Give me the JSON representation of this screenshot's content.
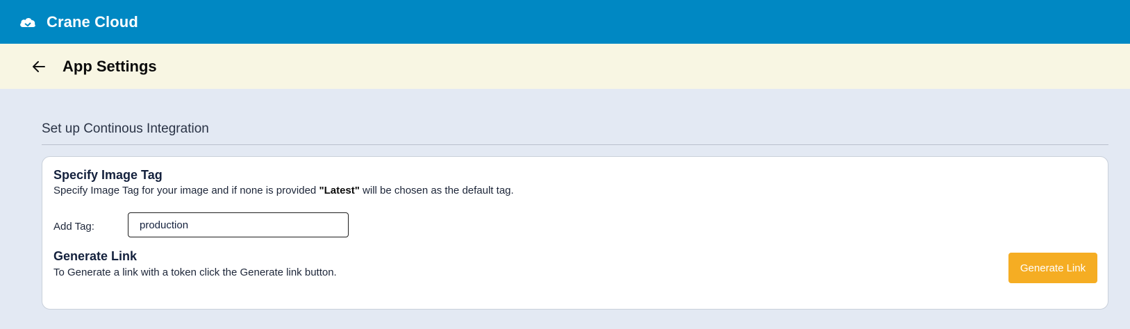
{
  "header": {
    "brand": "Crane Cloud",
    "logo_icon": "cloud-icon"
  },
  "subheader": {
    "back_icon": "arrow-left-icon",
    "title": "App Settings"
  },
  "section": {
    "title": "Set up Continous Integration"
  },
  "image_tag": {
    "heading": "Specify Image Tag",
    "description_prefix": "Specify Image Tag for your image and if none is provided ",
    "description_bold": "\"Latest\"",
    "description_suffix": " will be chosen as the default tag.",
    "label": "Add Tag:",
    "value": "production"
  },
  "generate_link": {
    "heading": "Generate Link",
    "description": "To Generate a link with a token click the Generate link button.",
    "button_label": "Generate Link"
  },
  "colors": {
    "topbar": "#0088c3",
    "subheader": "#f8f6e3",
    "page_bg": "#e3e9f3",
    "button": "#f5ad23"
  }
}
